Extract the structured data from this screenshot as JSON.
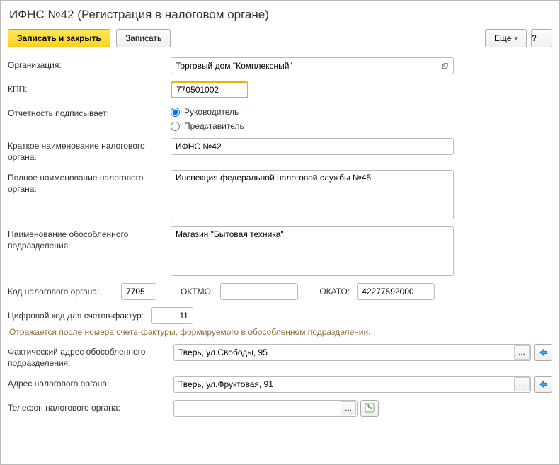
{
  "title": "ИФНС №42 (Регистрация в налоговом органе)",
  "toolbar": {
    "save_close": "Записать и закрыть",
    "save": "Записать",
    "more": "Еще",
    "help": "?"
  },
  "labels": {
    "org": "Организация:",
    "kpp": "КПП:",
    "signer": "Отчетность подписывает:",
    "short_name": "Краткое наименование налогового органа:",
    "full_name": "Полное наименование налогового органа:",
    "unit_name": "Наименование обособленного подразделения:",
    "tax_code": "Код налогового органа:",
    "oktmo": "ОКТМО:",
    "okato": "ОКАТО:",
    "digital_code": "Цифровой код для счетов-фактур:",
    "hint": "Отражается после номера счета-фактуры, формируемого в обособленном подразделении.",
    "fact_addr": "Фактический адрес обособленного подразделения:",
    "tax_addr": "Адрес налогового органа:",
    "phone": "Телефон налогового органа:"
  },
  "signer": {
    "head": "Руководитель",
    "rep": "Представитель"
  },
  "values": {
    "org": "Торговый дом \"Комплексный\"",
    "kpp": "770501002",
    "short_name": "ИФНС №42",
    "full_name": "Инспекция федеральной налоговой службы №45",
    "unit_name": "Магазин \"Бытовая техника\"",
    "tax_code": "7705",
    "oktmo": "",
    "okato": "42277592000",
    "digital_code": "11",
    "fact_addr": "Тверь, ул.Свободы, 95",
    "tax_addr": "Тверь, ул.Фруктовая, 91",
    "phone": ""
  }
}
